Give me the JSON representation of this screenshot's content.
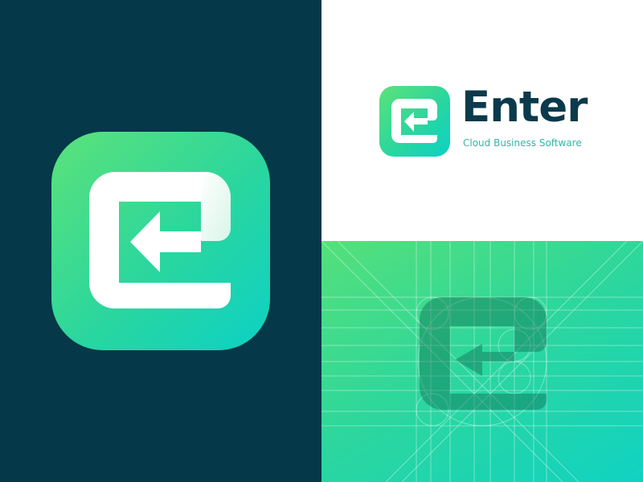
{
  "brand": {
    "name": "Enter",
    "tagline": "Cloud Business Software",
    "logo_icon": "enter-arrow-e-icon"
  },
  "colors": {
    "dark_background": "#053848",
    "wordmark": "#0a3a4b",
    "tagline": "#2fb8a6",
    "gradient_start": "#55e07a",
    "gradient_end": "#10d2c2"
  }
}
